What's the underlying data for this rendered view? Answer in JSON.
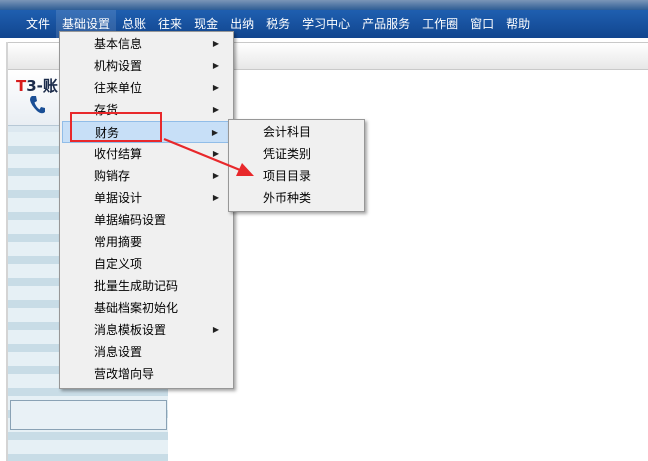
{
  "menubar": {
    "items": [
      "文件",
      "基础设置",
      "总账",
      "往来",
      "现金",
      "出纳",
      "税务",
      "学习中心",
      "产品服务",
      "工作圈",
      "窗口",
      "帮助"
    ],
    "active_index": 1
  },
  "sidebar": {
    "logo": "T3-账"
  },
  "menu": {
    "items": [
      {
        "label": "基本信息",
        "submenu": true
      },
      {
        "label": "机构设置",
        "submenu": true
      },
      {
        "label": "往来单位",
        "submenu": true
      },
      {
        "label": "存货",
        "submenu": true
      },
      {
        "label": "财务",
        "submenu": true
      },
      {
        "label": "收付结算",
        "submenu": true
      },
      {
        "label": "购销存",
        "submenu": true
      },
      {
        "label": "单据设计",
        "submenu": true
      },
      {
        "label": "单据编码设置",
        "submenu": false
      },
      {
        "label": "常用摘要",
        "submenu": false
      },
      {
        "label": "自定义项",
        "submenu": false
      },
      {
        "label": "批量生成助记码",
        "submenu": false
      },
      {
        "label": "基础档案初始化",
        "submenu": false
      },
      {
        "label": "消息模板设置",
        "submenu": true
      },
      {
        "label": "消息设置",
        "submenu": false
      },
      {
        "label": "营改增向导",
        "submenu": false
      }
    ],
    "highlighted_index": 4
  },
  "submenu": {
    "items": [
      "会计科目",
      "凭证类别",
      "项目目录",
      "外币种类"
    ]
  },
  "colors": {
    "menubar": "#1a56a8",
    "annotation": "#e8282b",
    "highlight": "#c7dff7"
  }
}
